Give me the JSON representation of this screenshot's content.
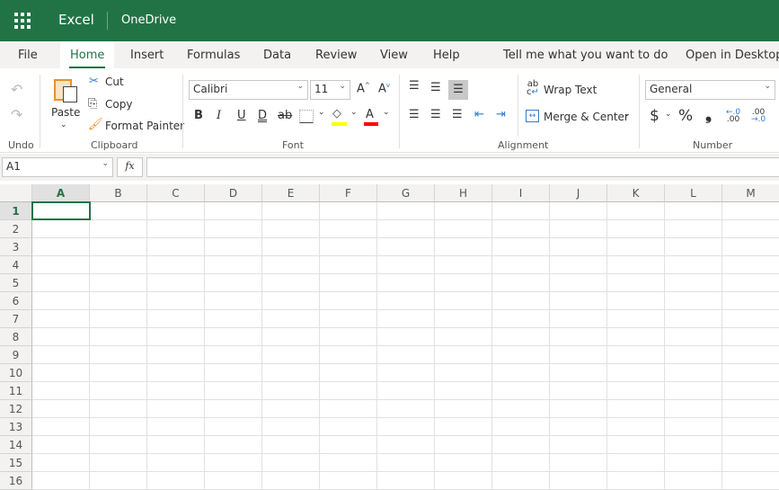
{
  "header": {
    "app_name": "Excel",
    "location": "OneDrive",
    "icon": "waffle-icon"
  },
  "tabs": [
    {
      "label": "File"
    },
    {
      "label": "Home",
      "active": true
    },
    {
      "label": "Insert"
    },
    {
      "label": "Formulas"
    },
    {
      "label": "Data"
    },
    {
      "label": "Review"
    },
    {
      "label": "View"
    },
    {
      "label": "Help"
    },
    {
      "label": "Tell me what you want to do"
    },
    {
      "label": "Open in Desktop App"
    }
  ],
  "ribbon": {
    "undo": {
      "group": "Undo"
    },
    "clipboard": {
      "group": "Clipboard",
      "paste": "Paste",
      "cut": "Cut",
      "copy": "Copy",
      "format_painter": "Format Painter"
    },
    "font": {
      "group": "Font",
      "font_name": "Calibri",
      "font_size": "11",
      "bold": "B",
      "italic": "I",
      "underline": "U",
      "double_underline": "D",
      "strike": "ab",
      "font_color_letter": "A",
      "highlight_color": "#ffff00",
      "font_color": "#ff0000"
    },
    "alignment": {
      "group": "Alignment",
      "wrap_text": "Wrap Text",
      "merge_center": "Merge & Center"
    },
    "number": {
      "group": "Number",
      "format": "General",
      "currency": "$",
      "percent": "%",
      "comma": "❟"
    }
  },
  "formula_bar": {
    "name_box": "A1",
    "fx": "fx",
    "value": ""
  },
  "grid": {
    "columns": [
      "A",
      "B",
      "C",
      "D",
      "E",
      "F",
      "G",
      "H",
      "I",
      "J",
      "K",
      "L",
      "M"
    ],
    "rows": [
      "1",
      "2",
      "3",
      "4",
      "5",
      "6",
      "7",
      "8",
      "9",
      "10",
      "11",
      "12",
      "13",
      "14",
      "15",
      "16"
    ],
    "active_cell": "A1"
  },
  "colors": {
    "brand": "#217346"
  }
}
